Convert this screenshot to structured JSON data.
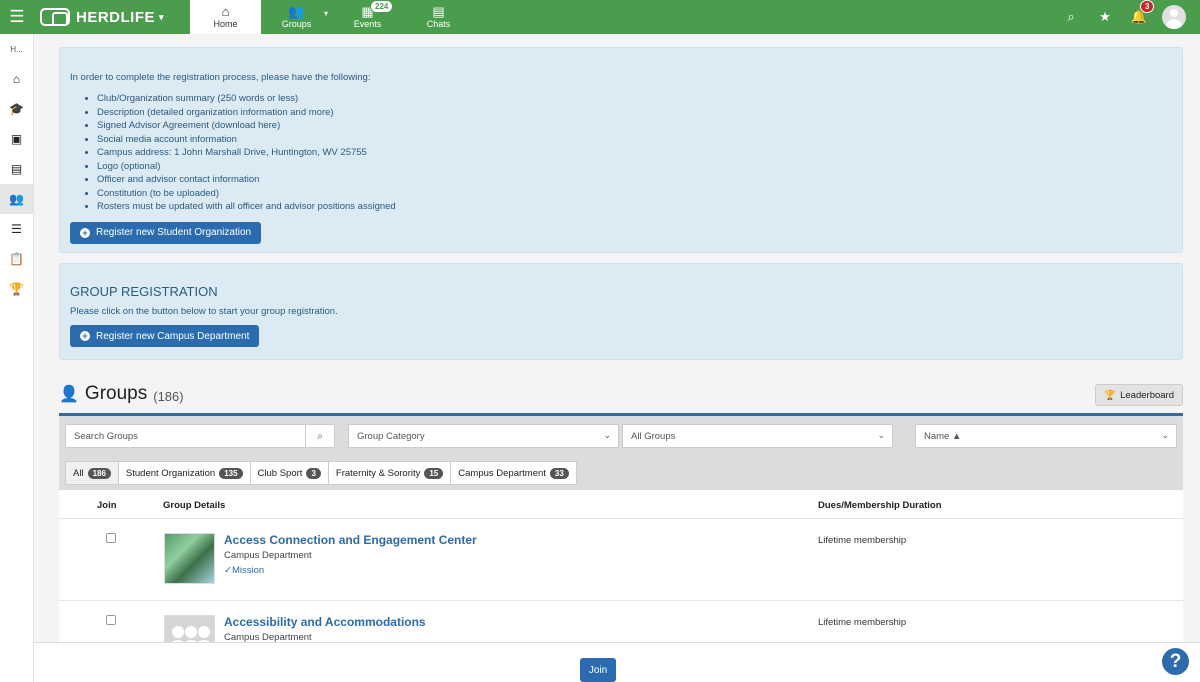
{
  "topbar": {
    "brand": "HERDLIFE",
    "tabs": [
      {
        "label": "Home",
        "icon": "home-icon"
      },
      {
        "label": "Groups",
        "icon": "groups-icon"
      },
      {
        "label": "Events",
        "icon": "calendar-icon",
        "badge": "224"
      },
      {
        "label": "Chats",
        "icon": "chat-icon"
      }
    ],
    "notifications_count": "3"
  },
  "sidebar": {
    "label": "H..."
  },
  "registration_panel": {
    "intro": "In order to complete the registration process, please have the following:",
    "items": [
      "Club/Organization summary (250 words or less)",
      "Description (detailed organization information and more)",
      "Signed Advisor Agreement (download here)",
      "Social media account information",
      "Campus address: 1 John Marshall Drive, Huntington, WV 25755",
      "Logo (optional)",
      "Officer and advisor contact information",
      "Constitution (to be uploaded)",
      "Rosters must be updated with all officer and advisor positions assigned"
    ],
    "button": "Register new Student Organization"
  },
  "group_registration": {
    "title": "GROUP REGISTRATION",
    "text": "Please click on the button below to start your group registration.",
    "button": "Register new Campus Department"
  },
  "groups": {
    "title": "Groups",
    "count": "(186)",
    "leaderboard": "Leaderboard",
    "search_placeholder": "Search Groups",
    "category_select": "Group Category",
    "groups_select": "All Groups",
    "sort_select": "Name ▲",
    "chips": [
      {
        "label": "All",
        "count": "186"
      },
      {
        "label": "Student Organization",
        "count": "135"
      },
      {
        "label": "Club Sport",
        "count": "3"
      },
      {
        "label": "Fraternity & Sorority",
        "count": "15"
      },
      {
        "label": "Campus Department",
        "count": "33"
      }
    ],
    "columns": [
      "Join",
      "Group Details",
      "Dues/Membership Duration"
    ],
    "rows": [
      {
        "name": "Access Connection and Engagement Center",
        "category": "Campus Department",
        "mission": "Mission",
        "dues": "Lifetime membership"
      },
      {
        "name": "Accessibility and Accommodations",
        "category": "Campus Department",
        "dues": "Lifetime membership"
      }
    ],
    "join_button": "Join"
  },
  "help": "?"
}
